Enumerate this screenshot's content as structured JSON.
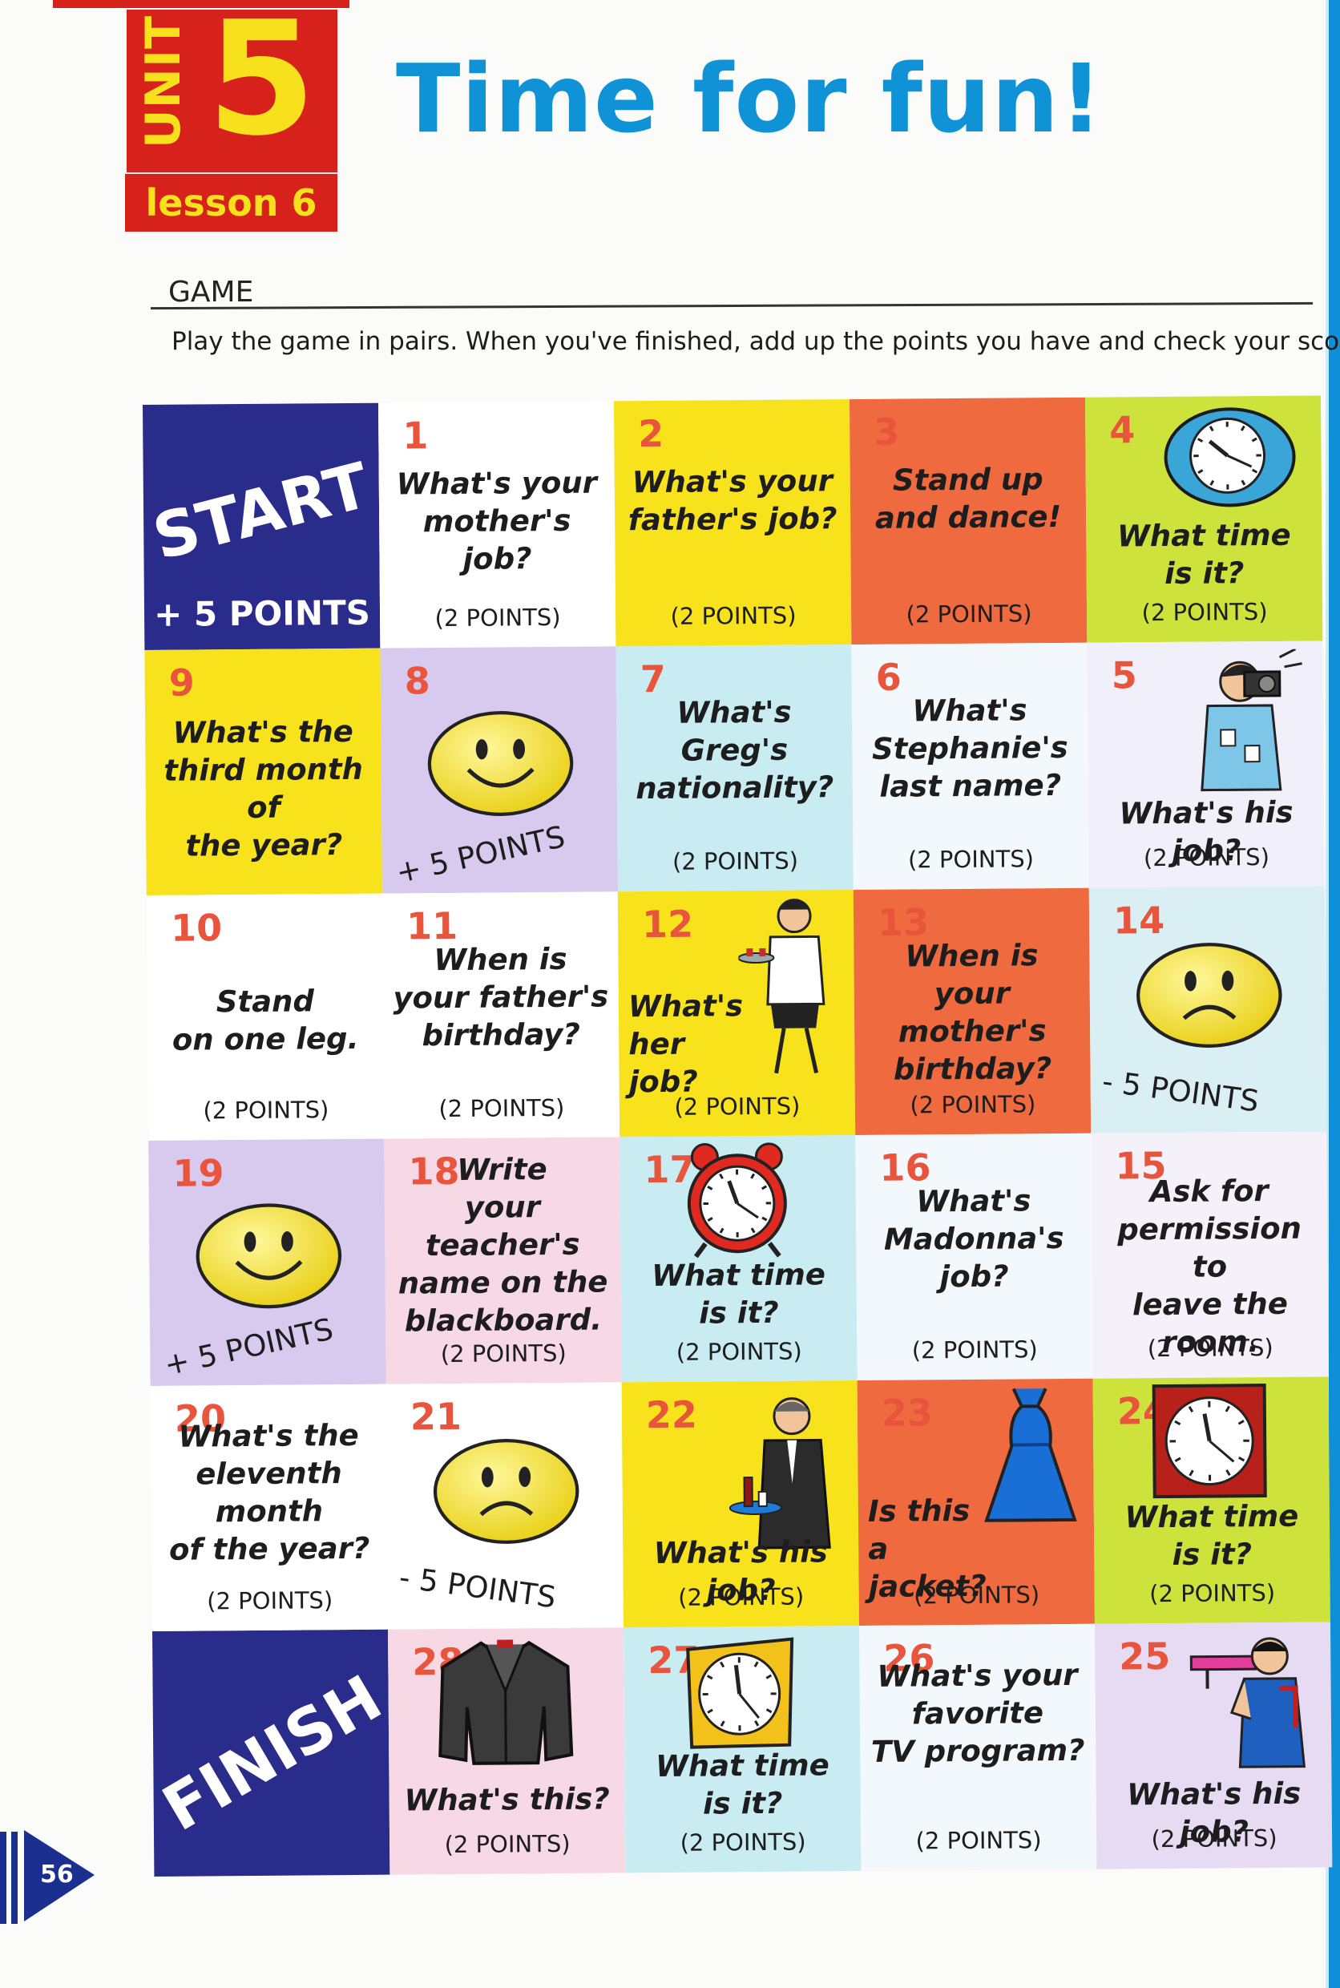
{
  "header": {
    "unit_label": "UNIT",
    "unit_number": "5",
    "lesson_label": "lesson 6",
    "title": "Time for fun!"
  },
  "section": {
    "heading": "GAME",
    "instructions": "Play the game in pairs. When you've finished, add up the points you have and check your score."
  },
  "board": {
    "start": {
      "label": "START",
      "points": "+ 5 POINTS"
    },
    "finish": {
      "label": "FINISH"
    },
    "cells": [
      {
        "n": "1",
        "text": "What's your\nmother's job?",
        "points": "(2 POINTS)"
      },
      {
        "n": "2",
        "text": "What's your\nfather's job?",
        "points": "(2 POINTS)"
      },
      {
        "n": "3",
        "text": "Stand up\nand dance!",
        "points": "(2 POINTS)"
      },
      {
        "n": "4",
        "text": "What time\nis it?",
        "points": "(2 POINTS)",
        "icon": "wall-clock-icon"
      },
      {
        "n": "5",
        "text": "What's his job?",
        "points": "(2 POINTS)",
        "icon": "photographer-icon"
      },
      {
        "n": "6",
        "text": "What's\nStephanie's\nlast name?",
        "points": "(2 POINTS)"
      },
      {
        "n": "7",
        "text": "What's Greg's\nnationality?",
        "points": "(2 POINTS)"
      },
      {
        "n": "8",
        "text": "",
        "points": "+ 5 POINTS",
        "icon": "smiley-happy-icon"
      },
      {
        "n": "9",
        "text": "What's the\nthird month of\nthe year?",
        "points": ""
      },
      {
        "n": "10",
        "text": "Stand\non one leg.",
        "points": "(2 POINTS)"
      },
      {
        "n": "11",
        "text": "When is\nyour father's\nbirthday?",
        "points": "(2 POINTS)"
      },
      {
        "n": "12",
        "text": "What's\nher job?",
        "points": "(2 POINTS)",
        "icon": "waitress-icon"
      },
      {
        "n": "13",
        "text": "When is your\nmother's\nbirthday?",
        "points": "(2 POINTS)"
      },
      {
        "n": "14",
        "text": "",
        "points": "- 5 POINTS",
        "icon": "smiley-sad-icon"
      },
      {
        "n": "15",
        "text": "Ask for\npermission to\nleave the room.",
        "points": "(2 POINTS)"
      },
      {
        "n": "16",
        "text": "What's\nMadonna's\njob?",
        "points": "(2 POINTS)"
      },
      {
        "n": "17",
        "text": "What time\nis it?",
        "points": "(2 POINTS)",
        "icon": "alarm-clock-icon"
      },
      {
        "n": "18",
        "text": "Write\nyour teacher's\nname on the\nblackboard.",
        "points": "(2 POINTS)"
      },
      {
        "n": "19",
        "text": "",
        "points": "+ 5 POINTS",
        "icon": "smiley-happy-icon"
      },
      {
        "n": "20",
        "text": "What's the\neleventh month\nof the year?",
        "points": "(2 POINTS)"
      },
      {
        "n": "21",
        "text": "",
        "points": "- 5 POINTS",
        "icon": "smiley-sad-icon"
      },
      {
        "n": "22",
        "text": "What's his job?",
        "points": "(2 POINTS)",
        "icon": "waiter-icon"
      },
      {
        "n": "23",
        "text": "Is this\na jacket?",
        "points": "(2 POINTS)",
        "icon": "dress-icon"
      },
      {
        "n": "24",
        "text": "What time\nis it?",
        "points": "(2 POINTS)",
        "icon": "square-clock-icon"
      },
      {
        "n": "25",
        "text": "What's his job?",
        "points": "(2 POINTS)",
        "icon": "mechanic-icon"
      },
      {
        "n": "26",
        "text": "What's your\nfavorite\nTV program?",
        "points": "(2 POINTS)"
      },
      {
        "n": "27",
        "text": "What time\nis it?",
        "points": "(2 POINTS)",
        "icon": "desk-clock-icon"
      },
      {
        "n": "28",
        "text": "What's this?",
        "points": "(2 POINTS)",
        "icon": "jacket-icon"
      }
    ]
  },
  "footer": {
    "page_number": "56"
  }
}
